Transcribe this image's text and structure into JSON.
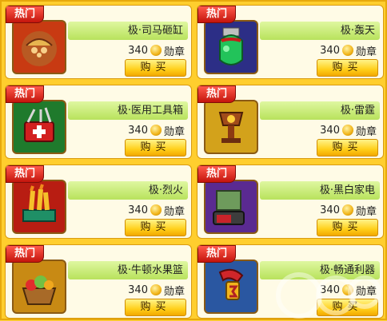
{
  "shop": {
    "hot_label": "热门",
    "currency_label": "勋章",
    "buy_label": "购买",
    "items": [
      {
        "name": "极·司马砸缸",
        "price": "340",
        "icon": "sack-icon",
        "bg": "#c83a12"
      },
      {
        "name": "极·轰天",
        "price": "340",
        "icon": "potion-icon",
        "bg": "#2c2e86"
      },
      {
        "name": "极·医用工具箱",
        "price": "340",
        "icon": "medkit-icon",
        "bg": "#1f7a2c"
      },
      {
        "name": "极·雷霆",
        "price": "340",
        "icon": "trophy-icon",
        "bg": "#d3a21b"
      },
      {
        "name": "极·烈火",
        "price": "340",
        "icon": "fire-icon",
        "bg": "#b81d12"
      },
      {
        "name": "极·黑白家电",
        "price": "340",
        "icon": "tv-icon",
        "bg": "#5a2a91"
      },
      {
        "name": "极·牛顿水果篮",
        "price": "340",
        "icon": "fruit-basket-icon",
        "bg": "#c88a14"
      },
      {
        "name": "极·畅通利器",
        "price": "340",
        "icon": "tool-icon",
        "bg": "#2a57a1"
      }
    ]
  }
}
